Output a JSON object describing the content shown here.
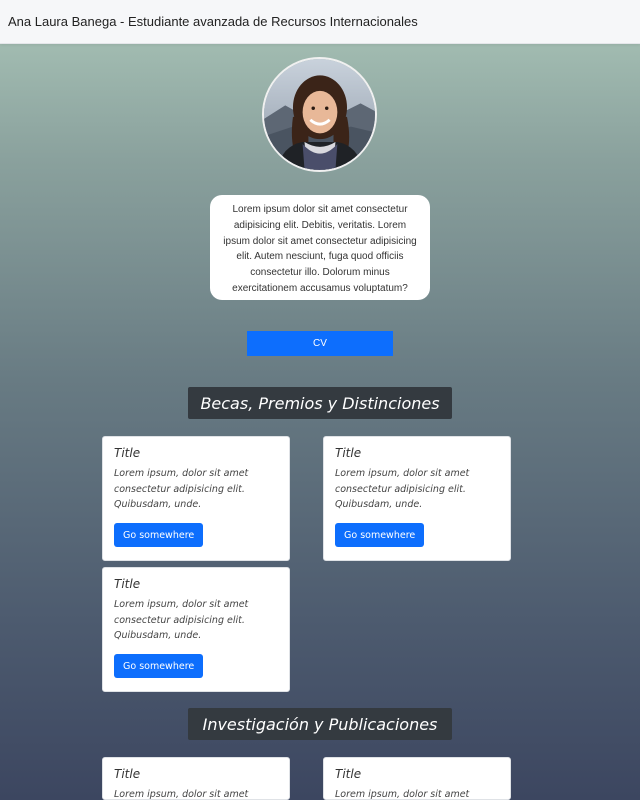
{
  "header": {
    "title": "Ana Laura Banega - Estudiante avanzada de Recursos Internacionales"
  },
  "profile": {
    "bio": "Lorem ipsum dolor sit amet consectetur adipisicing elit. Debitis, veritatis. Lorem ipsum dolor sit amet consectetur adipisicing elit. Autem nesciunt, fuga quod officiis consectetur illo. Dolorum minus exercitationem accusamus voluptatum?",
    "cv_label": "CV"
  },
  "sections": [
    {
      "title": "Becas, Premios y Distinciones",
      "cards": [
        {
          "title": "Title",
          "text": "Lorem ipsum, dolor sit amet consectetur adipisicing elit. Quibusdam, unde.",
          "button": "Go somewhere"
        },
        {
          "title": "Title",
          "text": "Lorem ipsum, dolor sit amet consectetur adipisicing elit. Quibusdam, unde.",
          "button": "Go somewhere"
        },
        {
          "title": "Title",
          "text": "Lorem ipsum, dolor sit amet consectetur adipisicing elit. Quibusdam, unde.",
          "button": "Go somewhere"
        }
      ]
    },
    {
      "title": "Investigación y Publicaciones",
      "cards": [
        {
          "title": "Title",
          "text": "Lorem ipsum, dolor sit amet"
        },
        {
          "title": "Title",
          "text": "Lorem ipsum, dolor sit amet"
        }
      ]
    }
  ],
  "colors": {
    "accent": "#0d6efd",
    "section_header_bg": "#343a40"
  }
}
